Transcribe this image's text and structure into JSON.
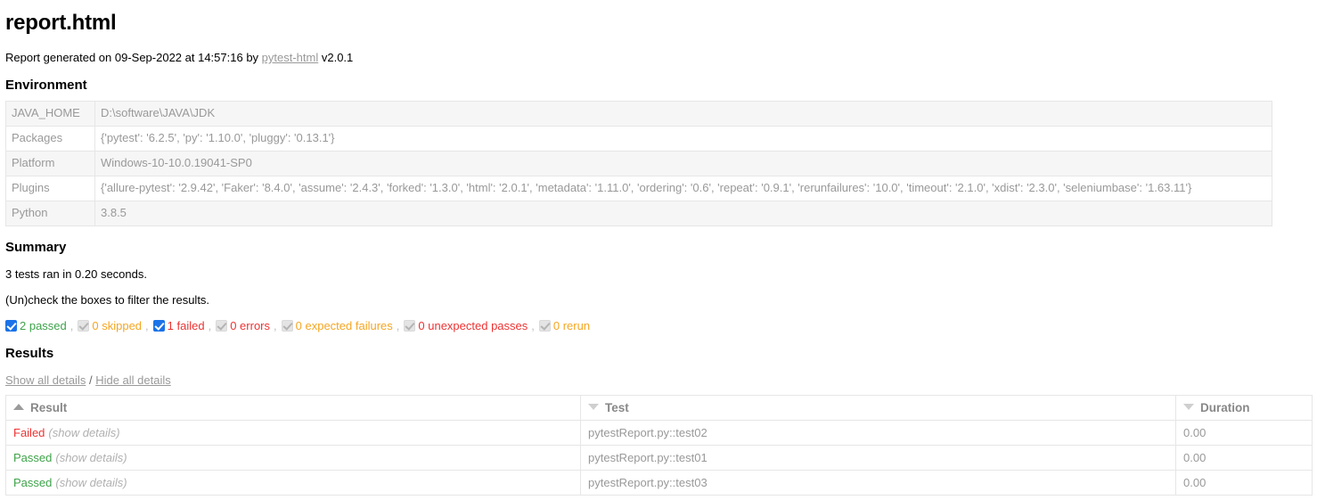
{
  "page": {
    "title": "report.html",
    "generated_prefix": "Report generated on 09-Sep-2022 at 14:57:16 by ",
    "generator_link": "pytest-html",
    "generator_version": " v2.0.1"
  },
  "environment": {
    "heading": "Environment",
    "rows": [
      {
        "key": "JAVA_HOME",
        "value": "D:\\software\\JAVA\\JDK"
      },
      {
        "key": "Packages",
        "value": "{'pytest': '6.2.5', 'py': '1.10.0', 'pluggy': '0.13.1'}"
      },
      {
        "key": "Platform",
        "value": "Windows-10-10.0.19041-SP0"
      },
      {
        "key": "Plugins",
        "value": "{'allure-pytest': '2.9.42', 'Faker': '8.4.0', 'assume': '2.4.3', 'forked': '1.3.0', 'html': '2.0.1', 'metadata': '1.11.0', 'ordering': '0.6', 'repeat': '0.9.1', 'rerunfailures': '10.0', 'timeout': '2.1.0', 'xdist': '2.3.0', 'seleniumbase': '1.63.11'}"
      },
      {
        "key": "Python",
        "value": "3.8.5"
      }
    ]
  },
  "summary": {
    "heading": "Summary",
    "run_line": "3 tests ran in 0.20 seconds.",
    "filter_hint": "(Un)check the boxes to filter the results.",
    "filters": [
      {
        "label": "2 passed",
        "checked": true,
        "color_class": "c-passed",
        "name": "passed",
        "trailing": ","
      },
      {
        "label": "0 skipped",
        "checked": false,
        "color_class": "c-skipped",
        "name": "skipped",
        "trailing": ","
      },
      {
        "label": "1 failed",
        "checked": true,
        "color_class": "c-failed",
        "name": "failed",
        "trailing": ","
      },
      {
        "label": "0 errors",
        "checked": false,
        "color_class": "c-error",
        "name": "errors",
        "trailing": ","
      },
      {
        "label": "0 expected failures",
        "checked": false,
        "color_class": "c-xfailed",
        "name": "expected-failures",
        "trailing": ","
      },
      {
        "label": "0 unexpected passes",
        "checked": false,
        "color_class": "c-xpassed",
        "name": "unexpected-passes",
        "trailing": ","
      },
      {
        "label": "0 rerun",
        "checked": false,
        "color_class": "c-rerun",
        "name": "rerun",
        "trailing": ""
      }
    ]
  },
  "results": {
    "heading": "Results",
    "show_all": "Show all details",
    "separator": "/",
    "hide_all": "Hide all details",
    "columns": [
      {
        "label": "Result",
        "sort": "asc"
      },
      {
        "label": "Test",
        "sort": "desc"
      },
      {
        "label": "Duration",
        "sort": "desc"
      }
    ],
    "show_details_label": "(show details)",
    "rows": [
      {
        "result": "Failed",
        "result_class": "res-failed",
        "test": "pytestReport.py::test02",
        "duration": "0.00"
      },
      {
        "result": "Passed",
        "result_class": "res-passed",
        "test": "pytestReport.py::test01",
        "duration": "0.00"
      },
      {
        "result": "Passed",
        "result_class": "res-passed",
        "test": "pytestReport.py::test03",
        "duration": "0.00"
      }
    ]
  },
  "colors": {
    "passed": "#3ea34a",
    "failed": "#ee3333",
    "warning": "#f5a623",
    "muted": "#999999",
    "checkbox_on": "#1a73e8",
    "border": "#e6e6e6",
    "row_stripe": "#f6f6f6"
  }
}
